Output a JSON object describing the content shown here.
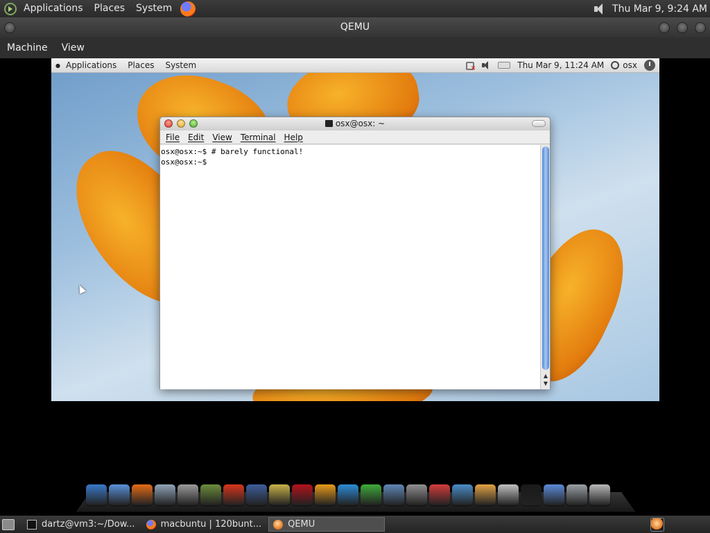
{
  "host_panel": {
    "menus": [
      "Applications",
      "Places",
      "System"
    ],
    "clock": "Thu Mar  9,  9:24 AM"
  },
  "qemu": {
    "title": "QEMU",
    "menus": [
      "Machine",
      "View"
    ]
  },
  "guest_panel": {
    "menus": [
      "Applications",
      "Places",
      "System"
    ],
    "clock": "Thu Mar  9, 11:24 AM",
    "user": "osx"
  },
  "terminal": {
    "title": "osx@osx: ~",
    "menus": [
      "File",
      "Edit",
      "View",
      "Terminal",
      "Help"
    ],
    "lines": [
      "osx@osx:~$ # barely functional!",
      "osx@osx:~$ "
    ]
  },
  "dock": {
    "icons": [
      {
        "name": "anchor-icon",
        "color": "#3a78c9"
      },
      {
        "name": "finder-icon",
        "color": "#5a8fd8"
      },
      {
        "name": "firefox-icon",
        "color": "#e46b16"
      },
      {
        "name": "mail-stamp-icon",
        "color": "#8fa3b8"
      },
      {
        "name": "microphone-icon",
        "color": "#9a9a9a"
      },
      {
        "name": "photo-icon",
        "color": "#6b8c3a"
      },
      {
        "name": "burner-icon",
        "color": "#d8361c"
      },
      {
        "name": "clapper-icon",
        "color": "#3c5e9a"
      },
      {
        "name": "star-icon",
        "color": "#c8b24a"
      },
      {
        "name": "book-icon",
        "color": "#b3121c"
      },
      {
        "name": "p-letter-icon",
        "color": "#e89a1a"
      },
      {
        "name": "w-letter-icon",
        "color": "#2d8bd6"
      },
      {
        "name": "k-letter-icon",
        "color": "#3faa3a"
      },
      {
        "name": "network-icon",
        "color": "#5f87b5"
      },
      {
        "name": "disc-icon",
        "color": "#8f8f8f"
      },
      {
        "name": "blocks-icon",
        "color": "#d43c3c"
      },
      {
        "name": "monitor-icon",
        "color": "#4a8cc9"
      },
      {
        "name": "font-book-icon",
        "color": "#e2a246"
      },
      {
        "name": "utility-icon",
        "color": "#c0c0c0"
      },
      {
        "name": "terminal-icon",
        "color": "#1a1a1a"
      },
      {
        "name": "user-group-icon",
        "color": "#5c8bd8"
      },
      {
        "name": "system-prefs-icon",
        "color": "#9aa0a6"
      },
      {
        "name": "trash-icon",
        "color": "#b8b8b8"
      }
    ]
  },
  "taskbar": {
    "tasks": [
      {
        "label": "dartz@vm3:~/Dow..."
      },
      {
        "label": "macbuntu | 120bunt..."
      },
      {
        "label": "QEMU"
      }
    ]
  }
}
